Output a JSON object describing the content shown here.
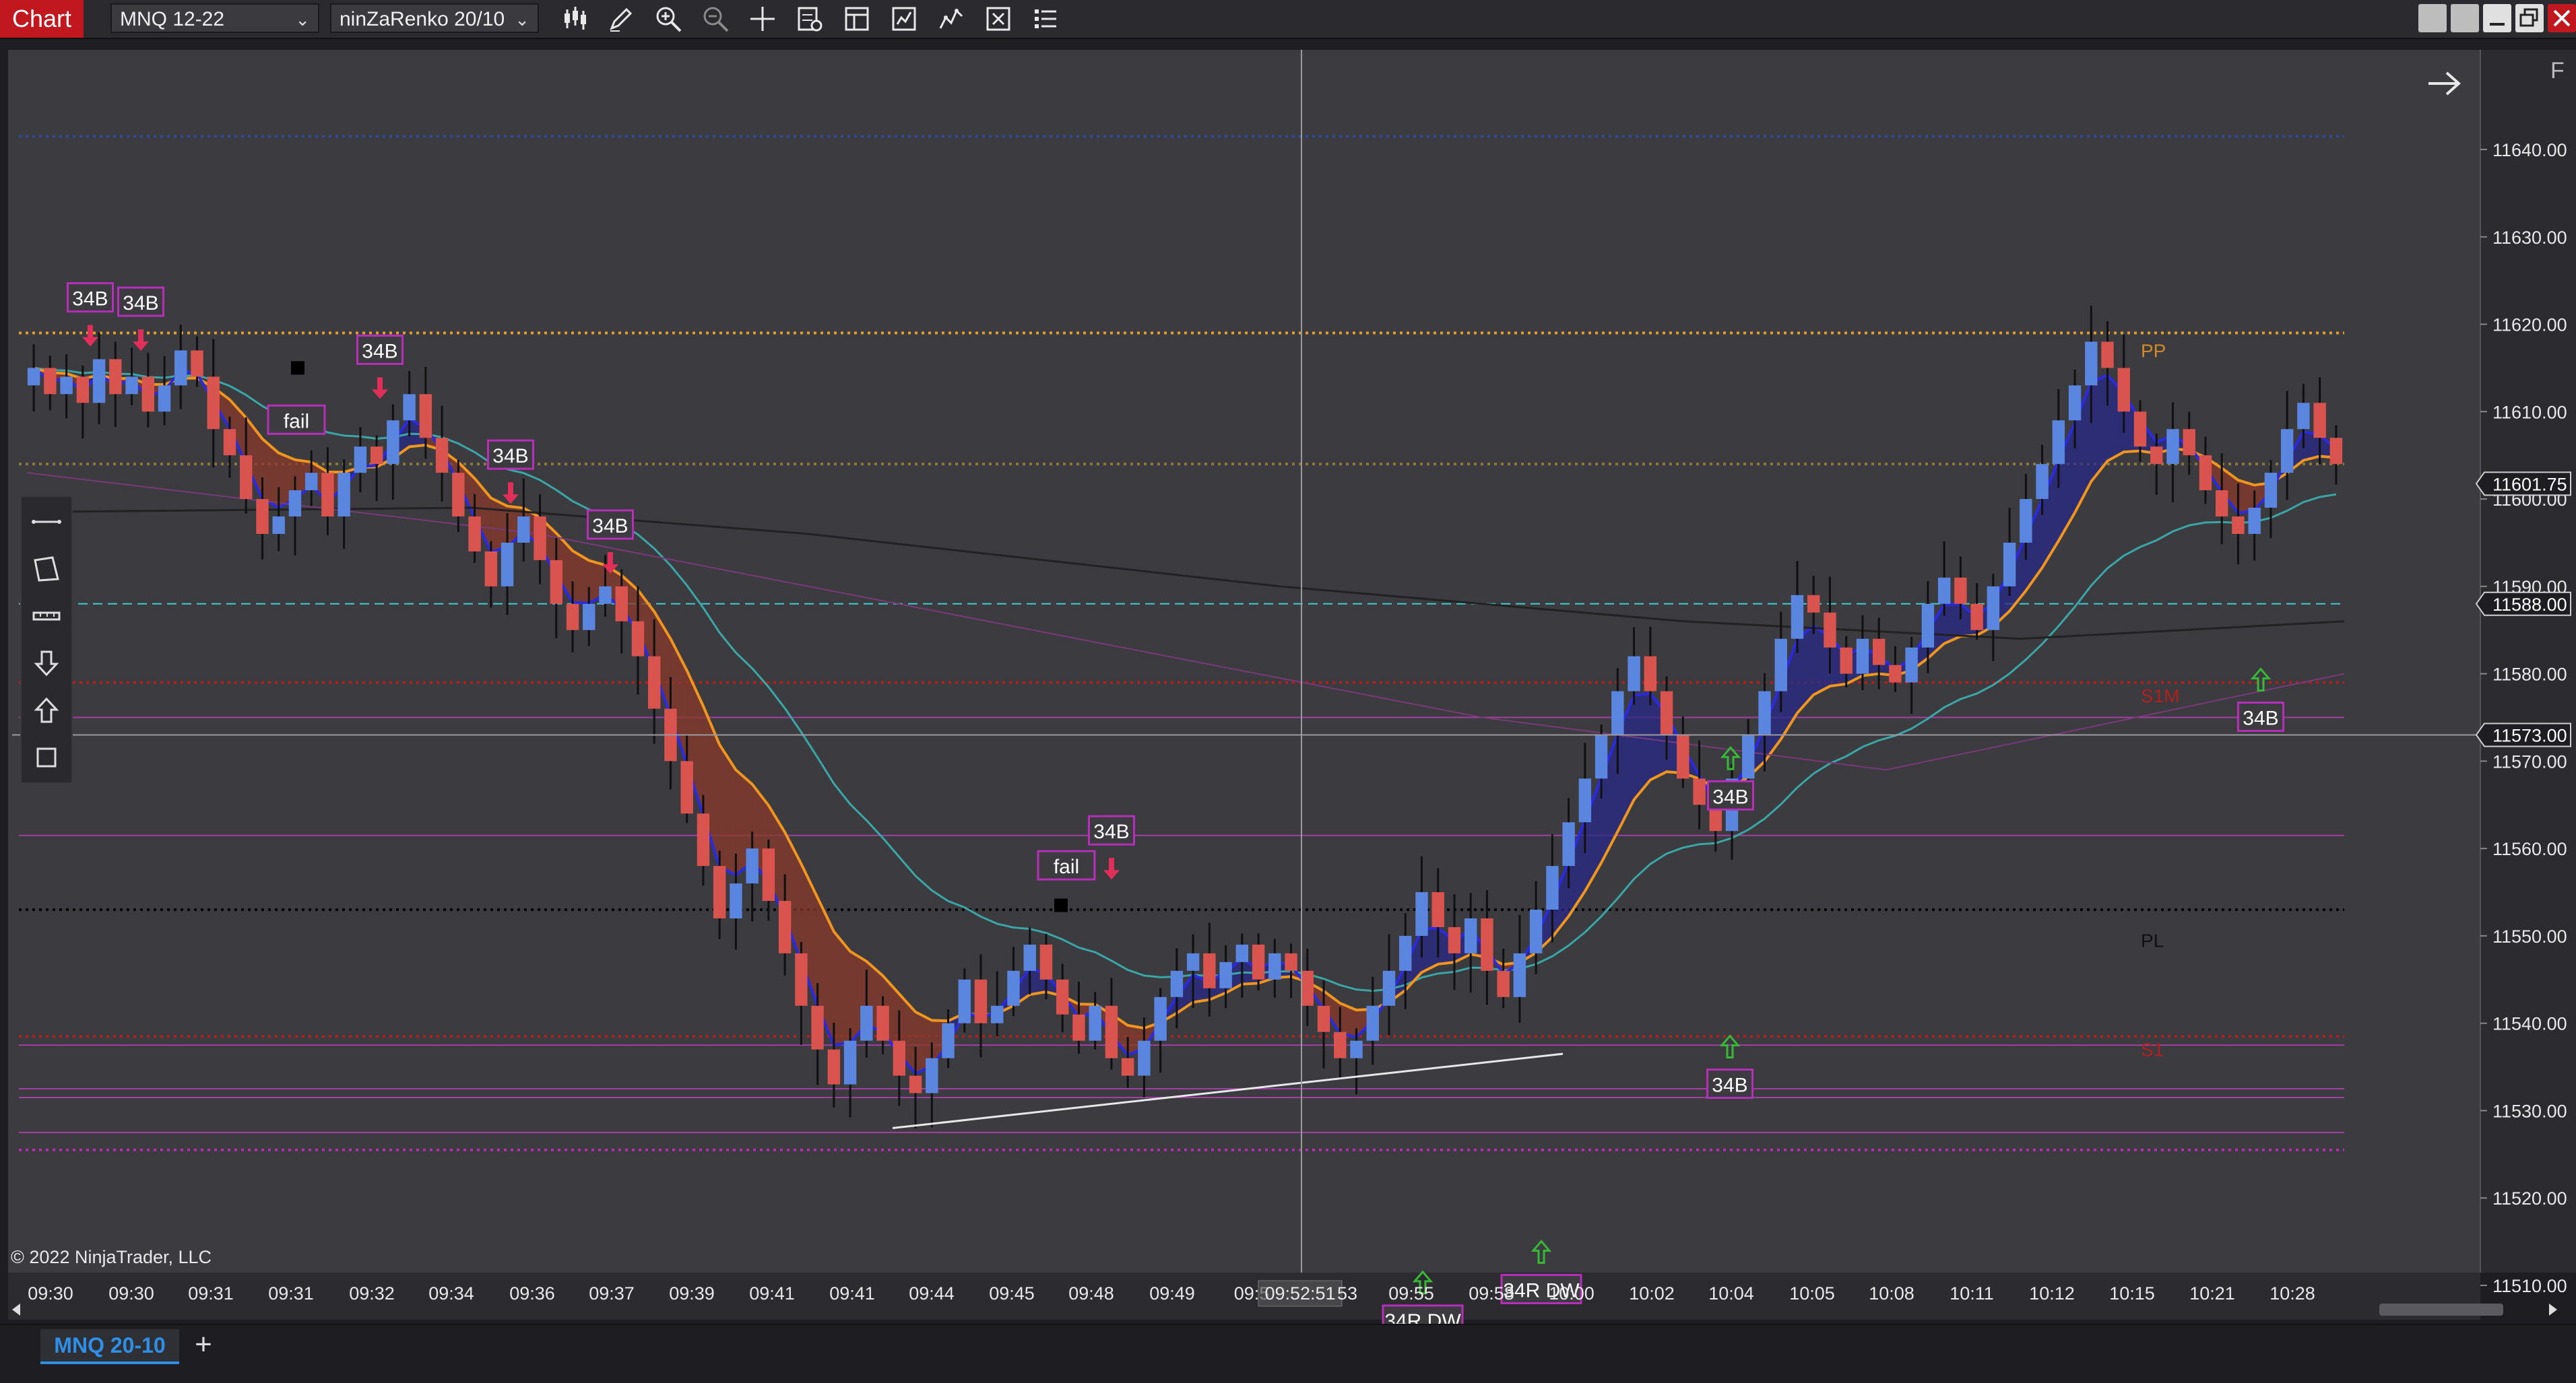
{
  "toolbar": {
    "chart_tab": "Chart",
    "instrument": "MNQ 12-22",
    "bar_type": "ninZaRenko 20/10",
    "icons": [
      "bar-type-icon",
      "draw-pencil-icon",
      "zoom-in-icon",
      "zoom-out-icon",
      "crosshair-icon",
      "properties-icon",
      "templates-icon",
      "strategies-icon",
      "indicators-icon",
      "data-box-icon",
      "chart-trader-icon"
    ]
  },
  "footer": {
    "tab_label": "MNQ 20-10",
    "add_label": "+",
    "copyright": "© 2022 NinjaTrader, LLC"
  },
  "chart_data": {
    "type": "candlestick",
    "title": "",
    "instrument": "MNQ 12-22",
    "bar_type": "ninZaRenko 20/10",
    "y_range": [
      11505,
      11642
    ],
    "y_ticks": [
      11510,
      11520,
      11530,
      11540,
      11550,
      11560,
      11570,
      11580,
      11590,
      11600,
      11610,
      11620,
      11630,
      11640
    ],
    "y_tick_labels": [
      "11510.00",
      "11520.00",
      "11530.00",
      "11540.00",
      "11550.00",
      "11560.00",
      "11570.00",
      "11580.00",
      "11590.00",
      "11600.00",
      "11610.00",
      "11620.00",
      "11630.00",
      "11640.00"
    ],
    "x_tick_labels": [
      "09:30",
      "09:30",
      "09:31",
      "09:31",
      "09:32",
      "09:34",
      "09:36",
      "09:37",
      "09:39",
      "09:41",
      "09:41",
      "09:44",
      "09:45",
      "09:48",
      "09:49",
      "09:5",
      "09:52:51",
      "53",
      "09:55",
      "09:58",
      "10:00",
      "10:02",
      "10:04",
      "10:05",
      "10:08",
      "10:11",
      "10:12",
      "10:15",
      "10:21",
      "10:28"
    ],
    "price_badges": [
      {
        "label": "11601.75",
        "value": 11601.75
      },
      {
        "label": "11588.00",
        "value": 11588.0
      },
      {
        "label": "11573.00",
        "value": 11573.0
      }
    ],
    "level_labels": [
      {
        "label": "PP",
        "value": 11617
      },
      {
        "label": "S1M",
        "value": 11577.5
      },
      {
        "label": "PL",
        "value": 11549.5
      },
      {
        "label": "S1",
        "value": 11537
      }
    ],
    "horizontal_lines": [
      {
        "value": 11641.5,
        "style": "dotted",
        "color": "#2e4a9a"
      },
      {
        "value": 11619,
        "style": "dotted",
        "color": "#e0a030"
      },
      {
        "value": 11604,
        "style": "dotted",
        "color": "#8a7a3a"
      },
      {
        "value": 11588,
        "style": "dashed",
        "color": "#3ad0d0"
      },
      {
        "value": 11579,
        "style": "dotted",
        "color": "#b02020"
      },
      {
        "value": 11575,
        "style": "solid",
        "color": "#a040a0"
      },
      {
        "value": 11573,
        "style": "solid",
        "color": "#9a9aa0"
      },
      {
        "value": 11561.5,
        "style": "solid",
        "color": "#a040a0"
      },
      {
        "value": 11553,
        "style": "dotted",
        "color": "#000000"
      },
      {
        "value": 11538.5,
        "style": "dotted",
        "color": "#b02020"
      },
      {
        "value": 11537.5,
        "style": "solid",
        "color": "#a040a0"
      },
      {
        "value": 11532.5,
        "style": "solid",
        "color": "#a040a0"
      },
      {
        "value": 11531.5,
        "style": "solid",
        "color": "#a040a0"
      },
      {
        "value": 11527.5,
        "style": "solid",
        "color": "#a040a0"
      },
      {
        "value": 11525.5,
        "style": "dotted",
        "color": "#b030b0"
      }
    ],
    "close_series": [
      11615,
      11612,
      11614,
      11611,
      11616,
      11612,
      11614,
      11610,
      11613,
      11617,
      11614,
      11608,
      11605,
      11600,
      11596,
      11598,
      11601,
      11603,
      11598,
      11603,
      11606,
      11604,
      11609,
      11612,
      11607,
      11603,
      11598,
      11594,
      11590,
      11595,
      11598,
      11593,
      11588,
      11585,
      11588,
      11590,
      11586,
      11582,
      11576,
      11570,
      11564,
      11558,
      11552,
      11556,
      11560,
      11554,
      11548,
      11542,
      11537,
      11533,
      11538,
      11542,
      11538,
      11534,
      11532,
      11536,
      11540,
      11545,
      11540,
      11542,
      11546,
      11549,
      11545,
      11541,
      11538,
      11542,
      11536,
      11534,
      11538,
      11543,
      11546,
      11548,
      11544,
      11547,
      11549,
      11545,
      11548,
      11546,
      11542,
      11539,
      11536,
      11538,
      11542,
      11546,
      11550,
      11555,
      11551,
      11548,
      11552,
      11546,
      11543,
      11548,
      11553,
      11558,
      11563,
      11568,
      11573,
      11578,
      11582,
      11578,
      11573,
      11568,
      11565,
      11562,
      11568,
      11573,
      11578,
      11584,
      11589,
      11587,
      11583,
      11580,
      11584,
      11581,
      11579,
      11583,
      11588,
      11591,
      11588,
      11585,
      11590,
      11595,
      11600,
      11604,
      11609,
      11613,
      11618,
      11615,
      11610,
      11606,
      11604,
      11608,
      11605,
      11601,
      11598,
      11596,
      11599,
      11603,
      11608,
      11611,
      11607,
      11604
    ],
    "annotations": [
      {
        "label": "34B",
        "type": "sell-signal"
      },
      {
        "label": "34B",
        "type": "sell-signal"
      },
      {
        "label": "34B",
        "type": "sell-signal"
      },
      {
        "label": "fail",
        "type": "fail"
      },
      {
        "label": "34B",
        "type": "sell-signal"
      },
      {
        "label": "34B",
        "type": "sell-signal"
      },
      {
        "label": "fail",
        "type": "fail"
      },
      {
        "label": "34B",
        "type": "sell-signal"
      },
      {
        "label": "34R DW",
        "type": "buy-signal"
      },
      {
        "label": "34R DW",
        "type": "buy-signal"
      },
      {
        "label": "34B",
        "type": "buy-signal"
      },
      {
        "label": "34B",
        "type": "buy-signal"
      },
      {
        "label": "34B",
        "type": "buy-signal"
      }
    ],
    "colors": {
      "background": "#3b3b40",
      "up_bar": "#5b86e0",
      "down_bar": "#d9534f",
      "fast_ma": "#2a2ae0",
      "slow_ma": "#f0961e",
      "cloud_bear": "#8a3a2a",
      "cloud_bull": "#2a2a88",
      "teal_ma": "#3aa6a6",
      "long_ma": "#222222",
      "signal_box": "#b52fb8",
      "sell_arrow": "#e0305a",
      "buy_arrow": "#38b838"
    },
    "grid": false,
    "legend": "none"
  }
}
